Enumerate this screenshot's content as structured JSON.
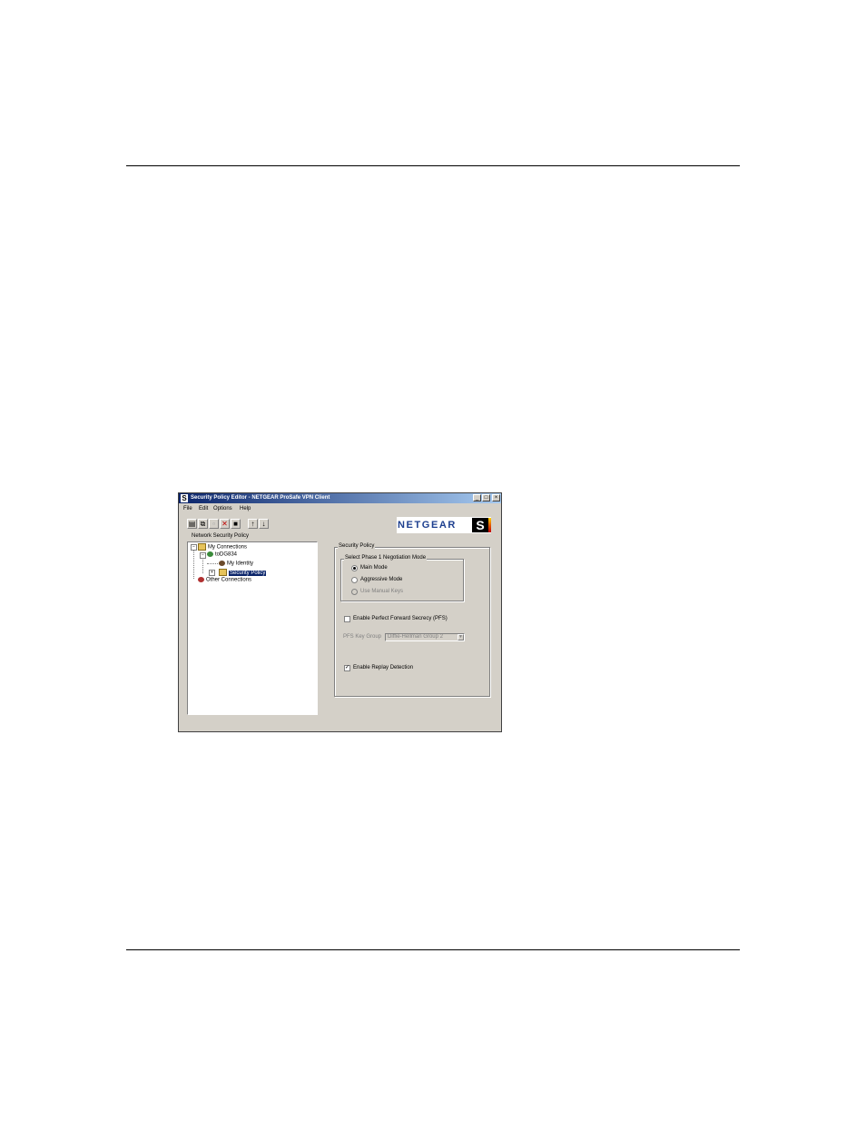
{
  "window": {
    "title": "Security Policy Editor - NETGEAR ProSafe VPN Client",
    "title_icon": "S",
    "controls": {
      "minimize": "_",
      "maximize": "□",
      "close": "×"
    }
  },
  "menu": [
    "File",
    "Edit",
    "Options",
    "Help"
  ],
  "toolbar": {
    "buttons": [
      {
        "icon": "new-connection-icon",
        "glyph": "▤"
      },
      {
        "icon": "copy-icon",
        "glyph": "⧉"
      },
      {
        "icon": "paste-icon",
        "glyph": "▫"
      },
      {
        "icon": "delete-icon",
        "glyph": "✕"
      },
      {
        "icon": "save-icon",
        "glyph": "■"
      },
      {
        "icon": "move-up-icon",
        "glyph": "↑"
      },
      {
        "icon": "move-down-icon",
        "glyph": "↓"
      }
    ]
  },
  "brand": {
    "name": "NETGEAR",
    "mark": "S"
  },
  "tree": {
    "label": "Network Security Policy",
    "my_connections": "My Connections",
    "connection": "toDG834",
    "my_identity": "My Identity",
    "security_policy": "Security Policy",
    "other_connections": "Other Connections"
  },
  "policy": {
    "group_title": "Security Policy",
    "phase1_title": "Select Phase 1 Negotiation Mode",
    "main_mode": "Main Mode",
    "aggressive_mode": "Aggressive Mode",
    "manual_keys": "Use Manual Keys",
    "selected_mode": "Main Mode",
    "pfs_label": "Enable Perfect Forward Secrecy (PFS)",
    "pfs_checked": false,
    "pfs_key_group_label": "PFS Key Group",
    "pfs_key_group_value": "Diffie-Hellman Group 2",
    "replay_label": "Enable Replay Detection",
    "replay_checked": true
  },
  "colors": {
    "titlebar_start": "#0a246a",
    "titlebar_end": "#a6caf0",
    "window_bg": "#d4d0c8",
    "brand_text": "#1d3f8f",
    "selection": "#0a246a"
  }
}
